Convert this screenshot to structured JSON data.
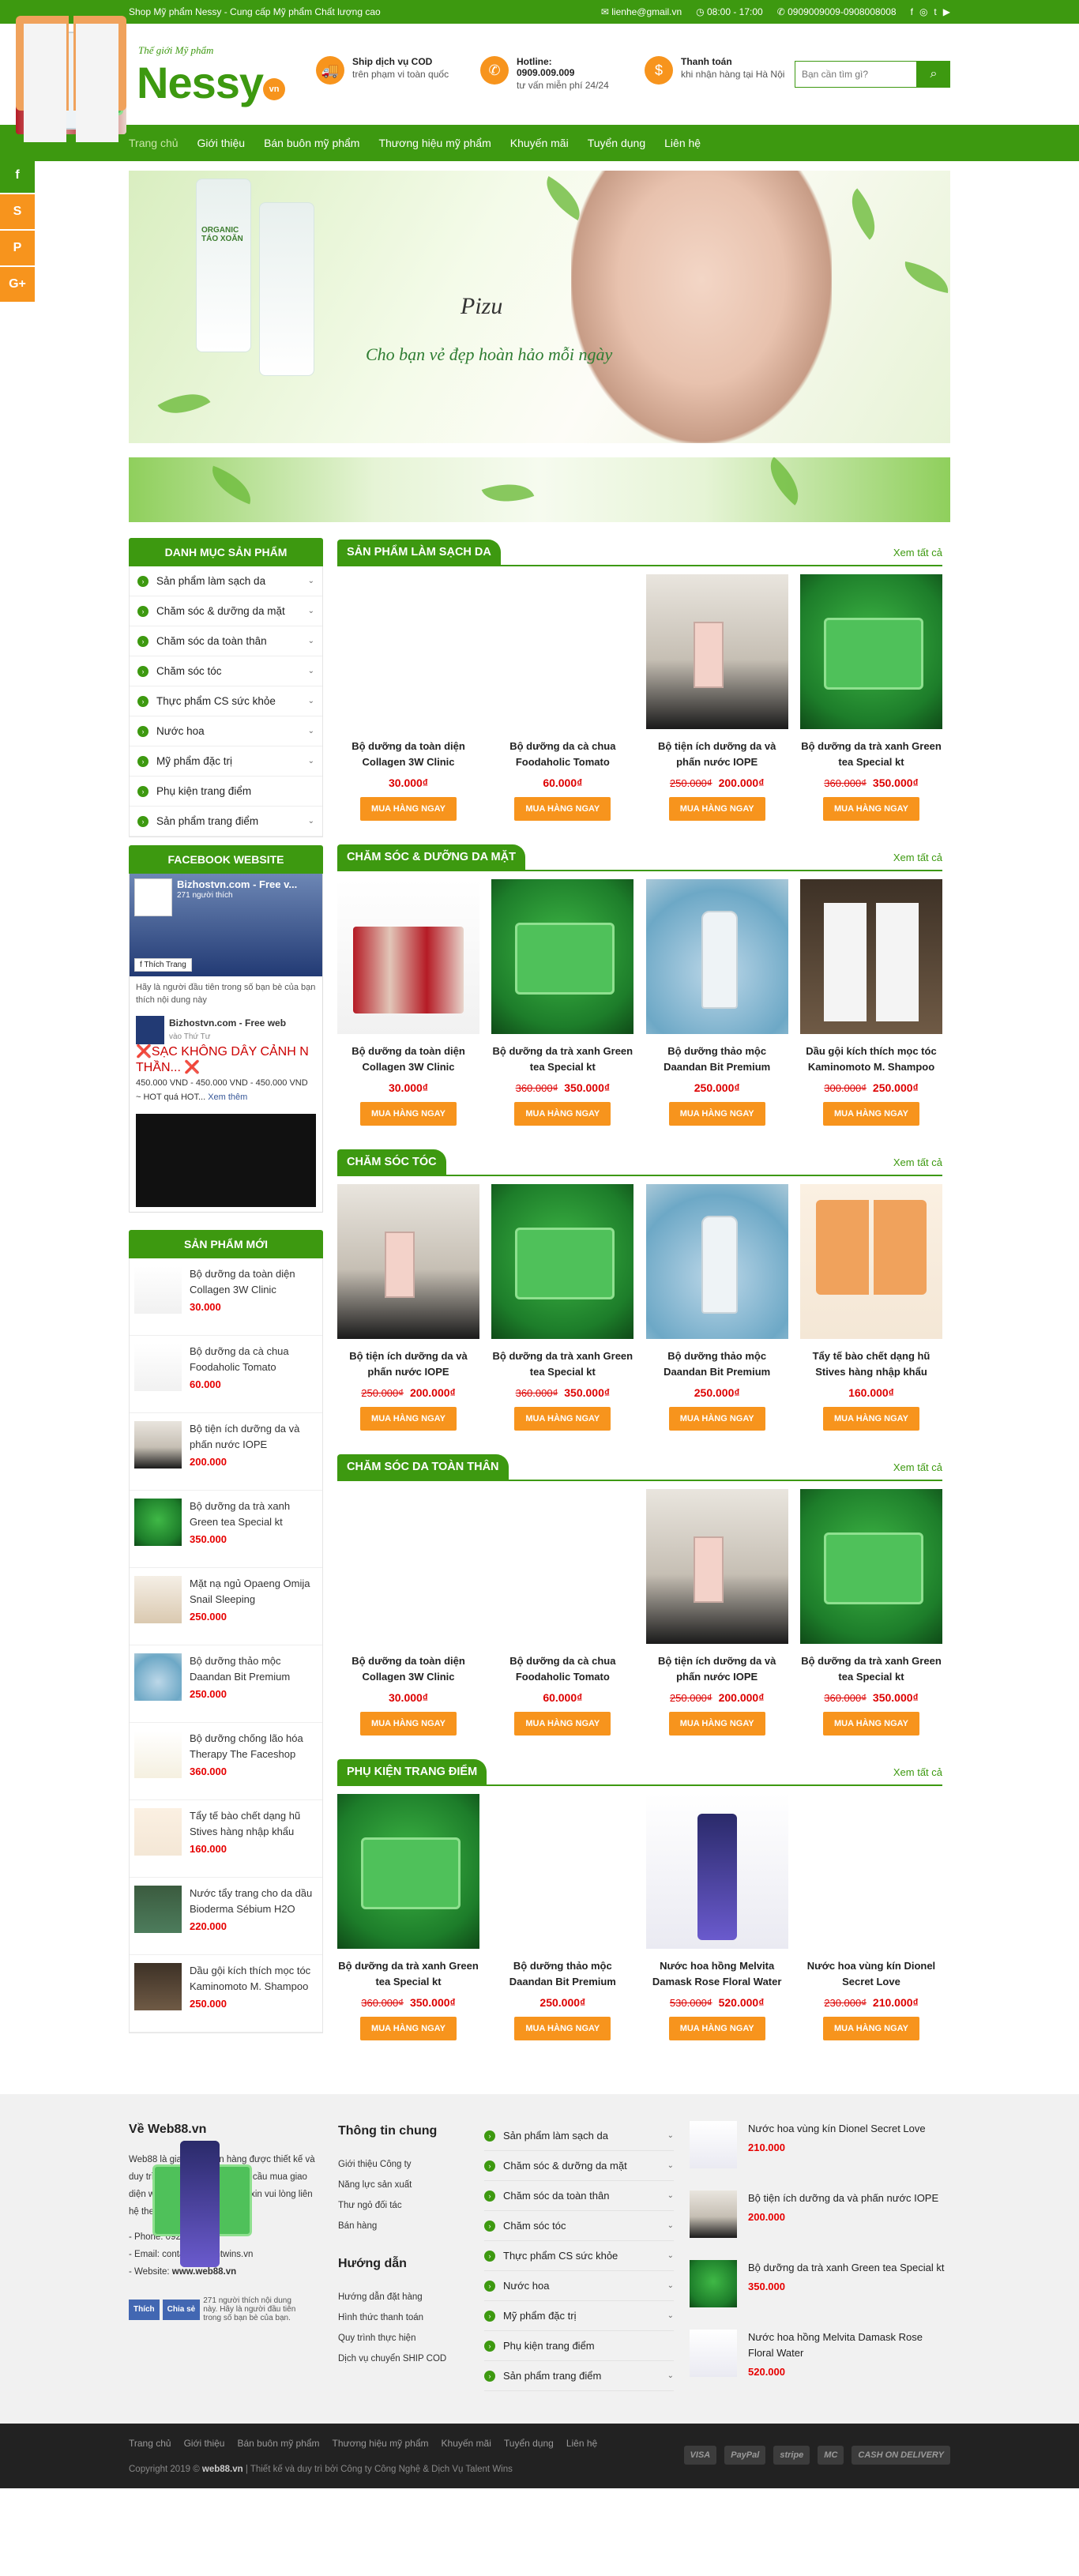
{
  "topbar": {
    "left_text": "Shop Mỹ phẩm Nessy - Cung cấp Mỹ phẩm Chất lượng cao",
    "email": "lienhe@gmail.vn",
    "hours": "08:00 - 17:00",
    "phone": "0909009009-0908008008",
    "social_icons": [
      "facebook-icon",
      "instagram-icon",
      "twitter-icon",
      "youtube-icon"
    ]
  },
  "header": {
    "logo_tagline": "Thế giới Mỹ phẩm",
    "logo_name": "Nessy",
    "logo_suffix": "vn",
    "info": [
      {
        "icon": "truck-icon",
        "title": "Ship dịch vụ COD",
        "text": "trên phạm vi toàn quốc"
      },
      {
        "icon": "phone-icon",
        "title": "Hotline:",
        "text1": "0909.009.009",
        "text2": "tư vấn miễn phí 24/24"
      },
      {
        "icon": "payment-icon",
        "title": "Thanh toán",
        "text": "khi nhận hàng tại Hà Nội"
      }
    ],
    "search_placeholder": "Bạn cần tìm gì?"
  },
  "nav": [
    "Trang chủ",
    "Giới thiệu",
    "Bán buôn mỹ phẩm",
    "Thương hiệu mỹ phẩm",
    "Khuyến mãi",
    "Tuyển dụng",
    "Liên hệ"
  ],
  "banner": {
    "brand": "Pizu",
    "slogan": "Cho bạn vẻ đẹp hoàn hảo mỗi ngày",
    "product_label": "ORGANIC TÁO XOĂN"
  },
  "sidebar": {
    "cat_title": "DANH MỤC SẢN PHẨM",
    "categories": [
      {
        "label": "Sản phẩm làm sạch da",
        "has_children": true
      },
      {
        "label": "Chăm sóc & dưỡng da mặt",
        "has_children": true
      },
      {
        "label": "Chăm sóc da toàn thân",
        "has_children": true
      },
      {
        "label": "Chăm sóc tóc",
        "has_children": true
      },
      {
        "label": "Thực phẩm CS sức khỏe",
        "has_children": true
      },
      {
        "label": "Nước hoa",
        "has_children": true
      },
      {
        "label": "Mỹ phẩm đặc trị",
        "has_children": true
      },
      {
        "label": "Phụ kiện trang điểm",
        "has_children": false
      },
      {
        "label": "Sản phẩm trang điểm",
        "has_children": true
      }
    ],
    "fb_title": "FACEBOOK WEBSITE",
    "fb": {
      "page_name": "Bizhostvn.com - Free v...",
      "page_likes": "271 người thích",
      "like_label": "Thích Trang",
      "invite": "Hãy là người đầu tiên trong số bạn bè của bạn thích nội dung này",
      "post_name": "Bizhostvn.com - Free web",
      "post_sub": "vào Thứ Tư",
      "post_text": "❌SẠC KHÔNG DÂY CẢNH N THẦN... ❌",
      "post_price": "450.000 VND - 450.000 VND - 450.000 VND",
      "post_more": "~ HOT quá HOT...",
      "see_more": "Xem thêm"
    },
    "new_title": "SẢN PHẨM MỚI",
    "new_products": [
      {
        "name": "Bộ dưỡng da toàn diện Collagen 3W Clinic",
        "price": "30.000",
        "img": "im-coll"
      },
      {
        "name": "Bộ dưỡng da cà chua Foodaholic Tomato",
        "price": "60.000",
        "img": "im-coll"
      },
      {
        "name": "Bộ tiện ích dưỡng da và phấn nước IOPE",
        "price": "200.000",
        "img": "im-iope"
      },
      {
        "name": "Bộ dưỡng da trà xanh Green tea Special kt",
        "price": "350.000",
        "img": "im-box"
      },
      {
        "name": "Mặt nạ ngủ Opaeng Omija Snail Sleeping",
        "price": "250.000",
        "img": "im-mask"
      },
      {
        "name": "Bộ dưỡng thảo mộc Daandan Bit Premium",
        "price": "250.000",
        "img": "im-bit"
      },
      {
        "name": "Bộ dưỡng chống lão hóa Therapy The Faceshop",
        "price": "360.000",
        "img": "im-faceshop"
      },
      {
        "name": "Tẩy tế bào chết dạng hũ Stives hàng nhập khẩu",
        "price": "160.000",
        "img": "im-stives"
      },
      {
        "name": "Nước tẩy trang cho da dầu Bioderma Sébium H2O",
        "price": "220.000",
        "img": "im-bioderma"
      },
      {
        "name": "Dầu gội kích thích mọc tóc Kaminomoto M. Shampoo",
        "price": "250.000",
        "img": "im-shamp"
      }
    ]
  },
  "buy_label": "MUA HÀNG NGAY",
  "see_all": "Xem tất cả",
  "sections": [
    {
      "title": "SẢN PHẨM LÀM SẠCH DA",
      "products": [
        {
          "name": "Bộ dưỡng da toàn diện Collagen 3W Clinic",
          "old": "",
          "price": "30.000₫",
          "img": "im-blank"
        },
        {
          "name": "Bộ dưỡng da cà chua Foodaholic Tomato",
          "old": "",
          "price": "60.000₫",
          "img": "im-blank"
        },
        {
          "name": "Bộ tiện ích dưỡng da và phấn nước IOPE",
          "old": "250.000₫",
          "price": "200.000₫",
          "img": "im-iope"
        },
        {
          "name": "Bộ dưỡng da trà xanh Green tea Special kt",
          "old": "360.000₫",
          "price": "350.000₫",
          "img": "im-box"
        }
      ]
    },
    {
      "title": "CHĂM SÓC & DƯỠNG DA MẶT",
      "products": [
        {
          "name": "Bộ dưỡng da toàn diện Collagen 3W Clinic",
          "old": "",
          "price": "30.000₫",
          "img": "im-coll"
        },
        {
          "name": "Bộ dưỡng da trà xanh Green tea Special kt",
          "old": "360.000₫",
          "price": "350.000₫",
          "img": "im-box"
        },
        {
          "name": "Bộ dưỡng thảo mộc Daandan Bit Premium",
          "old": "",
          "price": "250.000₫",
          "img": "im-bit"
        },
        {
          "name": "Dầu gội kích thích mọc tóc Kaminomoto M. Shampoo",
          "old": "300.000₫",
          "price": "250.000₫",
          "img": "im-shamp"
        }
      ]
    },
    {
      "title": "CHĂM SÓC TÓC",
      "products": [
        {
          "name": "Bộ tiện ích dưỡng da và phấn nước IOPE",
          "old": "250.000₫",
          "price": "200.000₫",
          "img": "im-iope"
        },
        {
          "name": "Bộ dưỡng da trà xanh Green tea Special kt",
          "old": "360.000₫",
          "price": "350.000₫",
          "img": "im-box"
        },
        {
          "name": "Bộ dưỡng thảo mộc Daandan Bit Premium",
          "old": "",
          "price": "250.000₫",
          "img": "im-bit"
        },
        {
          "name": "Tẩy tế bào chết dạng hũ Stives hàng nhập khẩu",
          "old": "",
          "price": "160.000₫",
          "img": "im-stives"
        }
      ]
    },
    {
      "title": "CHĂM SÓC DA TOÀN THÂN",
      "products": [
        {
          "name": "Bộ dưỡng da toàn diện Collagen 3W Clinic",
          "old": "",
          "price": "30.000₫",
          "img": "im-blank"
        },
        {
          "name": "Bộ dưỡng da cà chua Foodaholic Tomato",
          "old": "",
          "price": "60.000₫",
          "img": "im-blank"
        },
        {
          "name": "Bộ tiện ích dưỡng da và phấn nước IOPE",
          "old": "250.000₫",
          "price": "200.000₫",
          "img": "im-iope"
        },
        {
          "name": "Bộ dưỡng da trà xanh Green tea Special kt",
          "old": "360.000₫",
          "price": "350.000₫",
          "img": "im-box"
        }
      ]
    },
    {
      "title": "PHỤ KIỆN TRANG ĐIỂM",
      "products": [
        {
          "name": "Bộ dưỡng da trà xanh Green tea Special kt",
          "old": "360.000₫",
          "price": "350.000₫",
          "img": "im-box"
        },
        {
          "name": "Bộ dưỡng thảo mộc Daandan Bit Premium",
          "old": "",
          "price": "250.000₫",
          "img": "im-blank"
        },
        {
          "name": "Nước hoa hồng Melvita Damask Rose Floral Water",
          "old": "530.000₫",
          "price": "520.000₫",
          "img": "im-melvita"
        },
        {
          "name": "Nước hoa vùng kín Dionel Secret Love",
          "old": "230.000₫",
          "price": "210.000₫",
          "img": "im-blank"
        }
      ]
    }
  ],
  "footer": {
    "about_title": "Về Web88.vn",
    "about_text": "Web88 là giao diện bán hàng được thiết kế và duy trì bởi Web88.vn. Mọi nhu cầu mua giao diện web, thắc mắc, tư vấn,... xin vui lòng liên hệ theo thông tin dưới đây:",
    "phone": "- Phone: 0927151535",
    "email": "- Email: contact@talentwins.vn",
    "website_prefix": "- Website:",
    "website": "www.web88.vn",
    "fb_like": "Thích",
    "fb_share": "Chia sẻ",
    "fb_count": "271 người thích nội dung này. Hãy là người đầu tiên trong số bạn bè của bạn.",
    "info_title": "Thông tin chung",
    "info_links": [
      "Giới thiệu Công ty",
      "Năng lực sản xuất",
      "Thư ngỏ đối tác",
      "Bán hàng"
    ],
    "guide_title": "Hướng dẫn",
    "guide_links": [
      "Hướng dẫn đặt hàng",
      "Hình thức thanh toán",
      "Quy trình thực hiện",
      "Dịch vụ chuyển SHIP COD"
    ],
    "categories": [
      {
        "label": "Sản phẩm làm sạch da",
        "has_children": true
      },
      {
        "label": "Chăm sóc & dưỡng da mặt",
        "has_children": true
      },
      {
        "label": "Chăm sóc da toàn thân",
        "has_children": true
      },
      {
        "label": "Chăm sóc tóc",
        "has_children": true
      },
      {
        "label": "Thực phẩm CS sức khỏe",
        "has_children": true
      },
      {
        "label": "Nước hoa",
        "has_children": true
      },
      {
        "label": "Mỹ phẩm đặc trị",
        "has_children": true
      },
      {
        "label": "Phụ kiện trang điểm",
        "has_children": false
      },
      {
        "label": "Sản phẩm trang điểm",
        "has_children": true
      }
    ],
    "products": [
      {
        "name": "Nước hoa vùng kín Dionel Secret Love",
        "price": "210.000",
        "img": "im-melvita"
      },
      {
        "name": "Bộ tiện ích dưỡng da và phấn nước IOPE",
        "price": "200.000",
        "img": "im-iope"
      },
      {
        "name": "Bộ dưỡng da trà xanh Green tea Special kt",
        "price": "350.000",
        "img": "im-box"
      },
      {
        "name": "Nước hoa hồng Melvita Damask Rose Floral Water",
        "price": "520.000",
        "img": "im-melvita"
      }
    ]
  },
  "bottom": {
    "links": [
      "Trang chủ",
      "Giới thiệu",
      "Bán buôn mỹ phẩm",
      "Thương hiệu mỹ phẩm",
      "Khuyến mãi",
      "Tuyển dụng",
      "Liên hệ"
    ],
    "copyright_prefix": "Copyright 2019 ©",
    "copyright_site": "web88.vn",
    "copyright_suffix": "| Thiết kế và duy trì bởi Công ty Công Nghệ & Dịch Vụ Talent Wins",
    "payments": [
      "VISA",
      "PayPal",
      "stripe",
      "MC",
      "CASH ON DELIVERY"
    ]
  },
  "colors": {
    "brand_green": "#3d9910",
    "accent_orange": "#f7941d",
    "price_red": "#e60000"
  }
}
